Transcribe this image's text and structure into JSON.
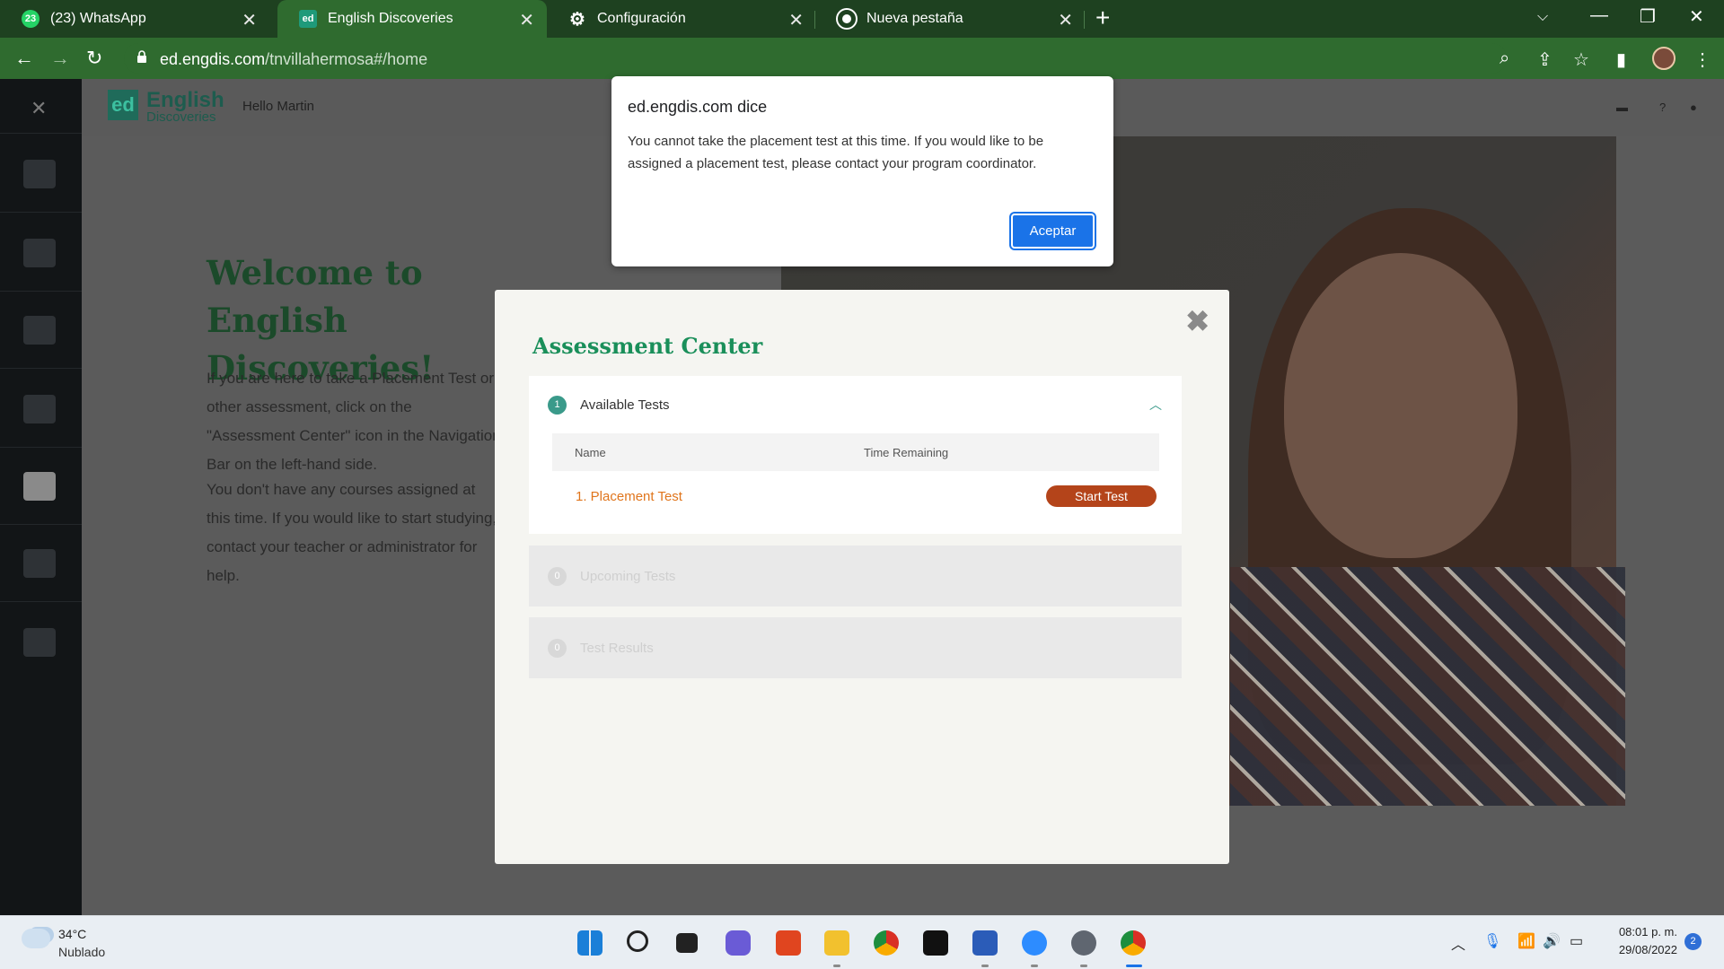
{
  "browser": {
    "tabs": [
      {
        "label": "(23) WhatsApp",
        "badge": "23"
      },
      {
        "label": "English Discoveries",
        "badge": "ed"
      },
      {
        "label": "Configuración"
      },
      {
        "label": "Nueva pestaña"
      }
    ],
    "url_host": "ed.engdis.com",
    "url_path": "/tnvillahermosa#/home"
  },
  "app": {
    "logo_mark": "ed",
    "logo_line1": "English",
    "logo_line2": "Discoveries",
    "greeting": "Hello Martin",
    "welcome_title": "Welcome to English Discoveries!",
    "intro_text": "If you are here to take a Placement Test or other assessment, click on the \"Assessment Center\" icon in the Navigation Bar on the left-hand side.",
    "intro_text_2": "You don't have any courses assigned at this time. If you would like to start studying, contact your teacher or administrator for help."
  },
  "assessment": {
    "title": "Assessment Center",
    "sections": [
      {
        "badge": "1",
        "label": "Available Tests"
      },
      {
        "badge": "0",
        "label": "Upcoming Tests"
      },
      {
        "badge": "0",
        "label": "Test Results"
      }
    ],
    "table_headers": {
      "name": "Name",
      "time": "Time Remaining"
    },
    "tests": [
      {
        "name": "1. Placement Test",
        "action": "Start Test"
      }
    ]
  },
  "alert": {
    "title": "ed.engdis.com dice",
    "message": "You cannot take the placement test at this time. If you would like to be assigned a placement test, please contact your program coordinator.",
    "button": "Aceptar"
  },
  "taskbar": {
    "temperature": "34°C",
    "condition": "Nublado",
    "time": "08:01 p. m.",
    "date": "29/08/2022",
    "notifications": "2"
  }
}
